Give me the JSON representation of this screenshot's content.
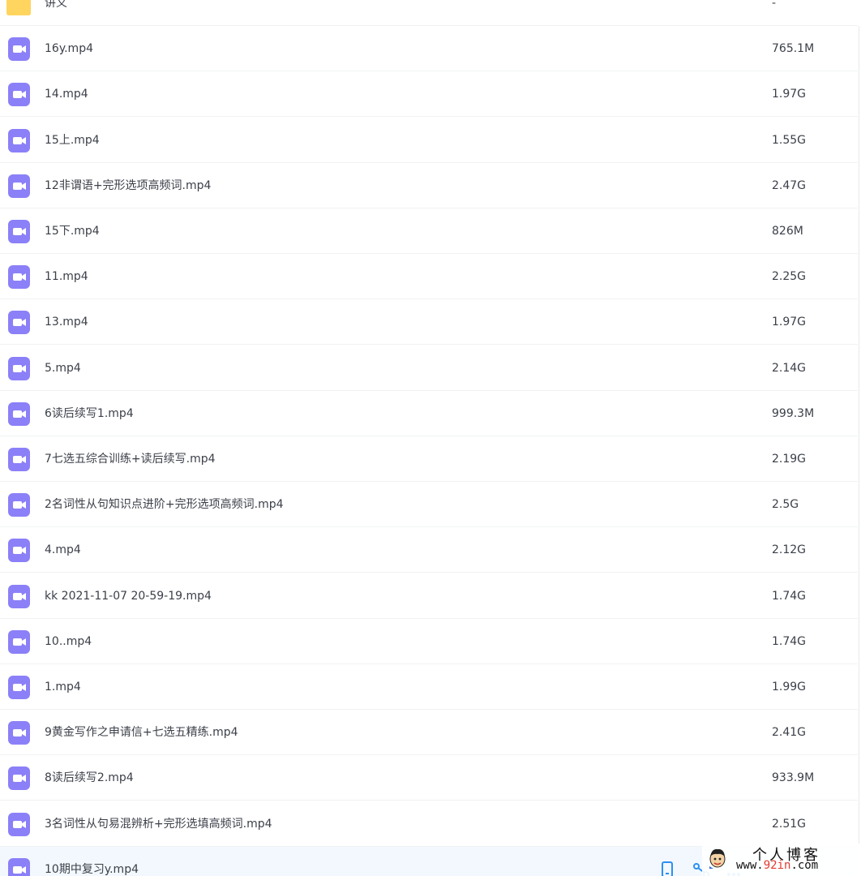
{
  "files": [
    {
      "name": "讲义",
      "size": "-",
      "type": "folder"
    },
    {
      "name": "16y.mp4",
      "size": "765.1M",
      "type": "video"
    },
    {
      "name": "14.mp4",
      "size": "1.97G",
      "type": "video"
    },
    {
      "name": "15上.mp4",
      "size": "1.55G",
      "type": "video"
    },
    {
      "name": "12非谓语+完形选项高频词.mp4",
      "size": "2.47G",
      "type": "video"
    },
    {
      "name": "15下.mp4",
      "size": "826M",
      "type": "video"
    },
    {
      "name": "11.mp4",
      "size": "2.25G",
      "type": "video"
    },
    {
      "name": "13.mp4",
      "size": "1.97G",
      "type": "video"
    },
    {
      "name": "5.mp4",
      "size": "2.14G",
      "type": "video"
    },
    {
      "name": "6读后续写1.mp4",
      "size": "999.3M",
      "type": "video"
    },
    {
      "name": "7七选五综合训练+读后续写.mp4",
      "size": "2.19G",
      "type": "video"
    },
    {
      "name": "2名词性从句知识点进阶+完形选项高频词.mp4",
      "size": "2.5G",
      "type": "video"
    },
    {
      "name": "4.mp4",
      "size": "2.12G",
      "type": "video"
    },
    {
      "name": "kk 2021-11-07 20-59-19.mp4",
      "size": "1.74G",
      "type": "video"
    },
    {
      "name": "10..mp4",
      "size": "1.74G",
      "type": "video"
    },
    {
      "name": "1.mp4",
      "size": "1.99G",
      "type": "video"
    },
    {
      "name": "9黄金写作之申请信+七选五精练.mp4",
      "size": "2.41G",
      "type": "video"
    },
    {
      "name": "8读后续写2.mp4",
      "size": "933.9M",
      "type": "video"
    },
    {
      "name": "3名词性从句易混辨析+完形选填高频词.mp4",
      "size": "2.51G",
      "type": "video"
    },
    {
      "name": "10期中复习y.mp4",
      "size": "",
      "type": "video",
      "hovered": true
    }
  ],
  "row_actions": [
    "phone-icon",
    "share-icon",
    "more-icon"
  ],
  "colors": {
    "video_icon": "#8b80f7",
    "folder_icon": "#ffd55f",
    "hover_row": "#f2f8fe",
    "text": "#3b3f48",
    "action": "#2e8ff3"
  },
  "watermark": {
    "title": "个人博客",
    "url_prefix": "www.",
    "url_highlight": "92in",
    "url_suffix": ".com"
  }
}
